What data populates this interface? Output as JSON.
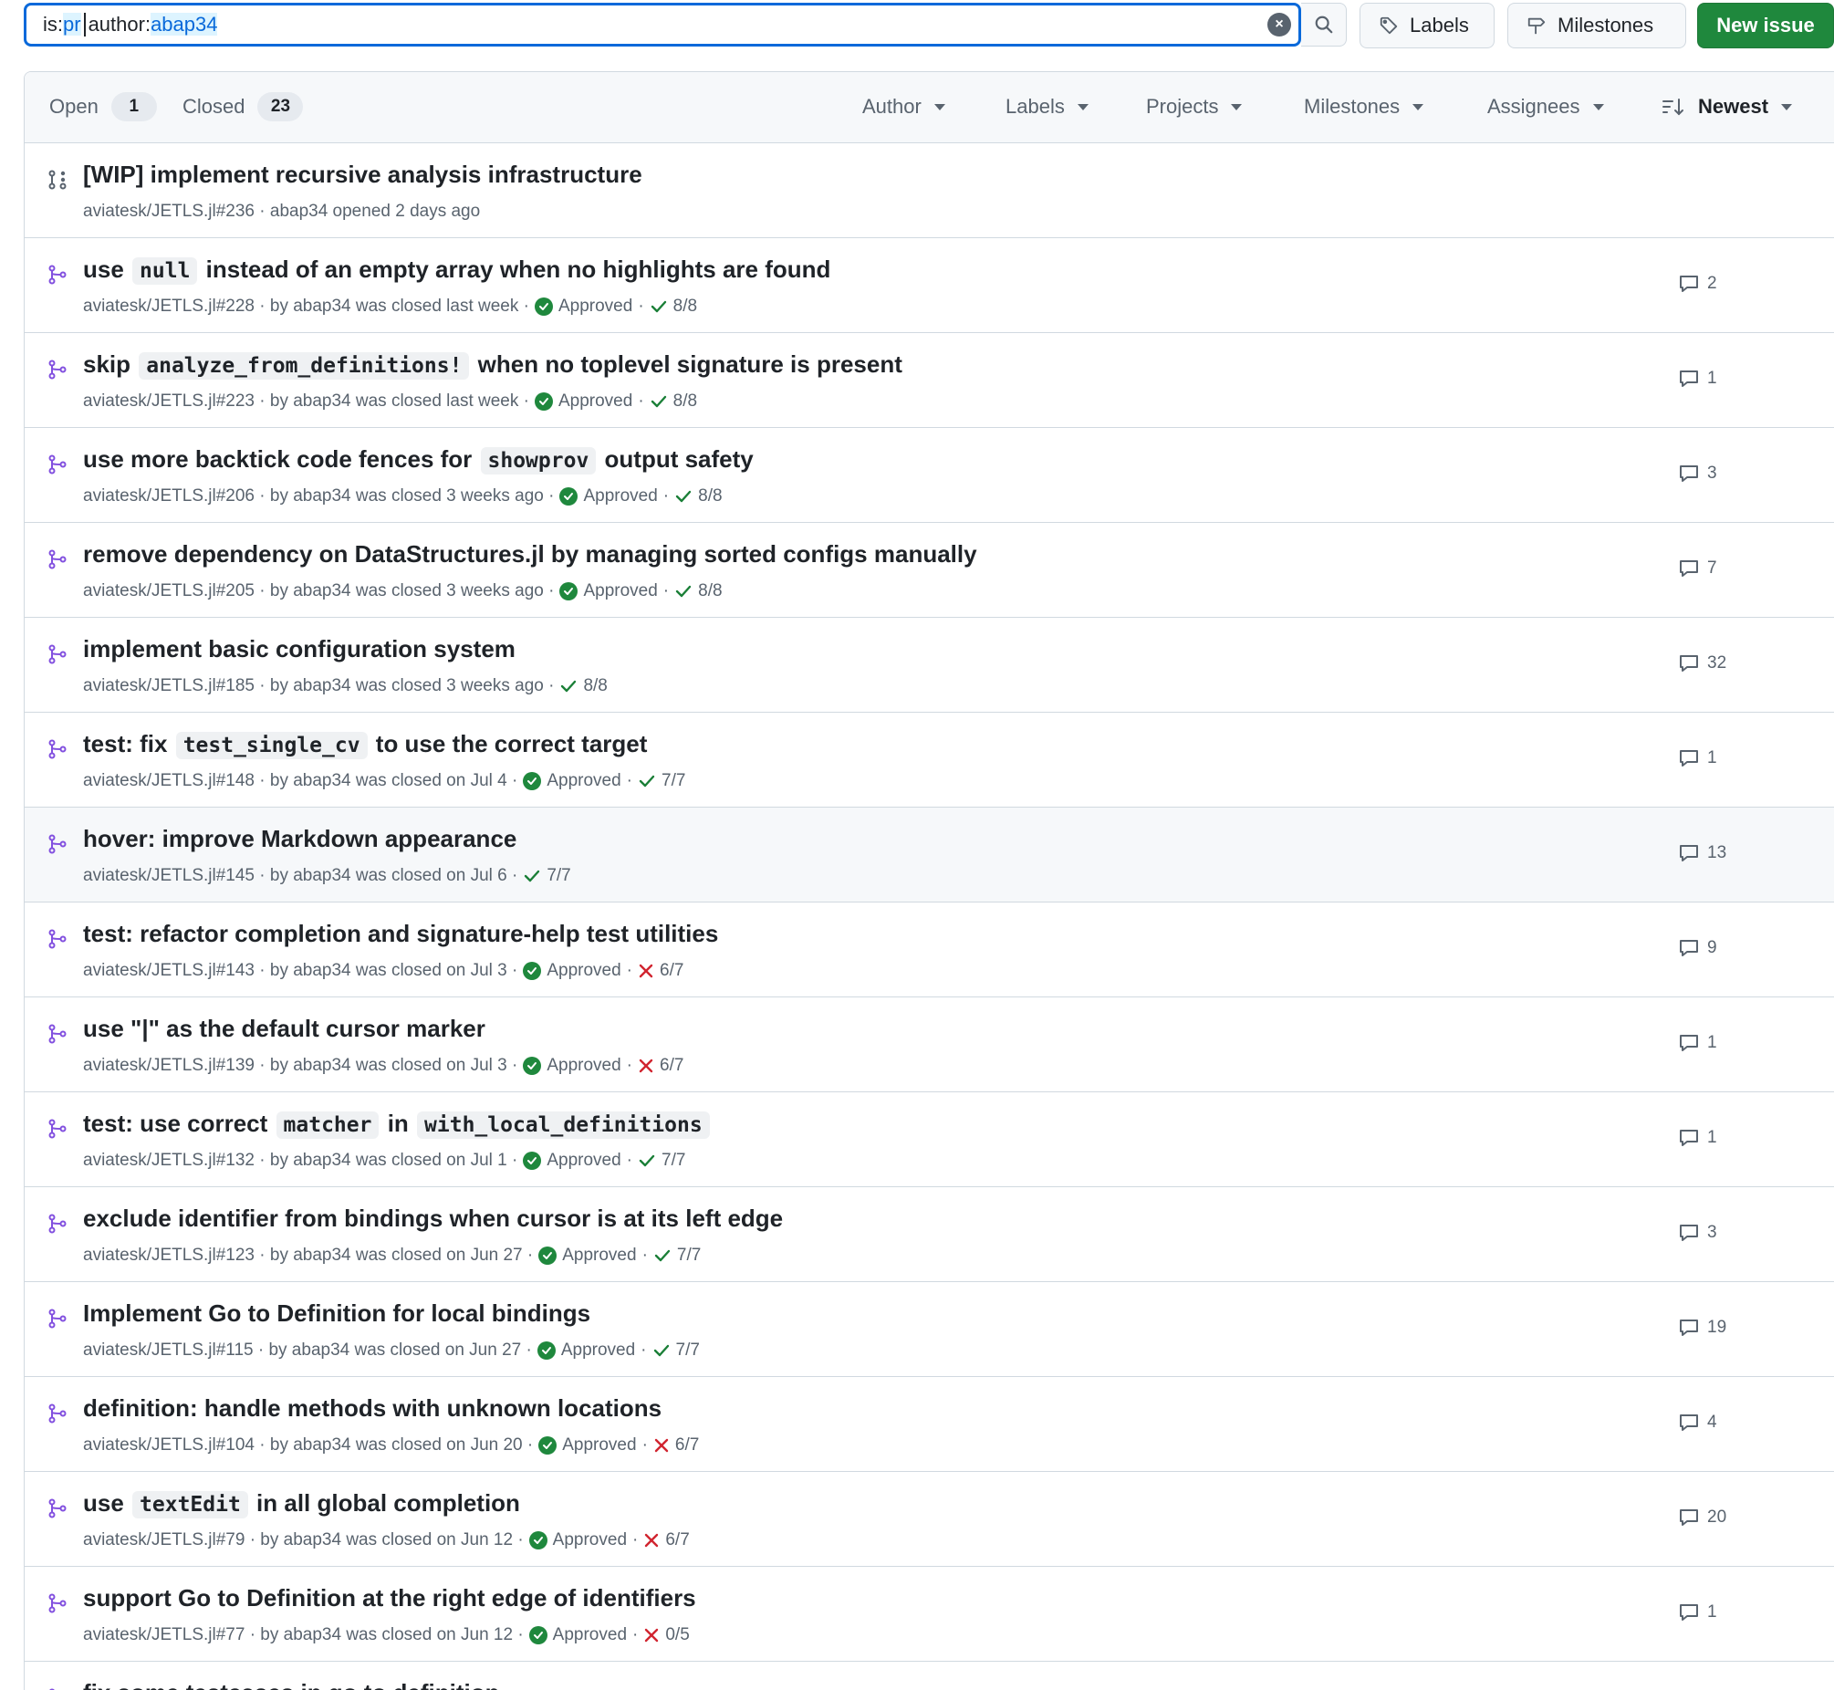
{
  "search": {
    "prefix": "is:",
    "is_value": "pr",
    "author_key": "author:",
    "author_value": "abap34"
  },
  "toolbar": {
    "labels": "Labels",
    "milestones": "Milestones",
    "new_issue": "New issue"
  },
  "states": {
    "open_label": "Open",
    "open_count": "1",
    "closed_label": "Closed",
    "closed_count": "23"
  },
  "filters": {
    "author": "Author",
    "labels": "Labels",
    "projects": "Projects",
    "milestones": "Milestones",
    "assignees": "Assignees",
    "sort": "Newest"
  },
  "colors": {
    "accent": "#0969da",
    "open_pr": "#59636e",
    "closed_pr": "#8250df",
    "success": "#1a7f37",
    "danger": "#d1242f",
    "button_green": "#1f883d"
  },
  "rows": [
    {
      "type": "draft",
      "title": [
        {
          "t": "[WIP] implement recursive analysis infrastructure"
        }
      ],
      "meta": "aviatesk/JETLS.jl#236 · abap34 opened 2 days ago",
      "approved": false,
      "ci": null,
      "ci_label": "",
      "comments": ""
    },
    {
      "type": "closed",
      "title": [
        {
          "t": "use "
        },
        {
          "c": "null"
        },
        {
          "t": " instead of an empty array when no highlights are found"
        }
      ],
      "meta": "aviatesk/JETLS.jl#228 · by abap34 was closed last week ·",
      "approved": true,
      "ci": "ok",
      "ci_label": "8/8",
      "comments": "2"
    },
    {
      "type": "closed",
      "title": [
        {
          "t": "skip "
        },
        {
          "c": "analyze_from_definitions!"
        },
        {
          "t": " when no toplevel signature is present"
        }
      ],
      "meta": "aviatesk/JETLS.jl#223 · by abap34 was closed last week ·",
      "approved": true,
      "ci": "ok",
      "ci_label": "8/8",
      "comments": "1"
    },
    {
      "type": "closed",
      "title": [
        {
          "t": "use more backtick code fences for "
        },
        {
          "c": "showprov"
        },
        {
          "t": " output safety"
        }
      ],
      "meta": "aviatesk/JETLS.jl#206 · by abap34 was closed 3 weeks ago ·",
      "approved": true,
      "ci": "ok",
      "ci_label": "8/8",
      "comments": "3"
    },
    {
      "type": "closed",
      "title": [
        {
          "t": "remove dependency on DataStructures.jl by managing sorted configs manually"
        }
      ],
      "meta": "aviatesk/JETLS.jl#205 · by abap34 was closed 3 weeks ago ·",
      "approved": true,
      "ci": "ok",
      "ci_label": "8/8",
      "comments": "7"
    },
    {
      "type": "closed",
      "title": [
        {
          "t": "implement basic configuration system"
        }
      ],
      "meta": "aviatesk/JETLS.jl#185 · by abap34 was closed 3 weeks ago ·",
      "approved": false,
      "ci": "ok",
      "ci_label": "8/8",
      "comments": "32"
    },
    {
      "type": "closed",
      "title": [
        {
          "t": "test: fix "
        },
        {
          "c": "test_single_cv"
        },
        {
          "t": " to use the correct target"
        }
      ],
      "meta": "aviatesk/JETLS.jl#148 · by abap34 was closed on Jul 4 ·",
      "approved": true,
      "ci": "ok",
      "ci_label": "7/7",
      "comments": "1"
    },
    {
      "type": "closed",
      "title": [
        {
          "t": "hover: improve Markdown appearance"
        }
      ],
      "meta": "aviatesk/JETLS.jl#145 · by abap34 was closed on Jul 6 ·",
      "approved": false,
      "ci": "ok",
      "ci_label": "7/7",
      "comments": "13",
      "highlight": true
    },
    {
      "type": "closed",
      "title": [
        {
          "t": "test: refactor completion and signature-help test utilities"
        }
      ],
      "meta": "aviatesk/JETLS.jl#143 · by abap34 was closed on Jul 3 ·",
      "approved": true,
      "ci": "fail",
      "ci_label": "6/7",
      "comments": "9"
    },
    {
      "type": "closed",
      "title": [
        {
          "t": "use \"|\" as the default cursor marker"
        }
      ],
      "meta": "aviatesk/JETLS.jl#139 · by abap34 was closed on Jul 3 ·",
      "approved": true,
      "ci": "fail",
      "ci_label": "6/7",
      "comments": "1"
    },
    {
      "type": "closed",
      "title": [
        {
          "t": "test: use correct "
        },
        {
          "c": "matcher"
        },
        {
          "t": " in "
        },
        {
          "c": "with_local_definitions"
        }
      ],
      "meta": "aviatesk/JETLS.jl#132 · by abap34 was closed on Jul 1 ·",
      "approved": true,
      "ci": "ok",
      "ci_label": "7/7",
      "comments": "1"
    },
    {
      "type": "closed",
      "title": [
        {
          "t": "exclude identifier from bindings when cursor is at its left edge"
        }
      ],
      "meta": "aviatesk/JETLS.jl#123 · by abap34 was closed on Jun 27 ·",
      "approved": true,
      "ci": "ok",
      "ci_label": "7/7",
      "comments": "3"
    },
    {
      "type": "closed",
      "title": [
        {
          "t": "Implement Go to Definition for local bindings"
        }
      ],
      "meta": "aviatesk/JETLS.jl#115 · by abap34 was closed on Jun 27 ·",
      "approved": true,
      "ci": "ok",
      "ci_label": "7/7",
      "comments": "19"
    },
    {
      "type": "closed",
      "title": [
        {
          "t": "definition: handle methods with unknown locations"
        }
      ],
      "meta": "aviatesk/JETLS.jl#104 · by abap34 was closed on Jun 20 ·",
      "approved": true,
      "ci": "fail",
      "ci_label": "6/7",
      "comments": "4"
    },
    {
      "type": "closed",
      "title": [
        {
          "t": "use "
        },
        {
          "c": "textEdit"
        },
        {
          "t": " in all global completion"
        }
      ],
      "meta": "aviatesk/JETLS.jl#79 · by abap34 was closed on Jun 12 ·",
      "approved": true,
      "ci": "fail",
      "ci_label": "6/7",
      "comments": "20"
    },
    {
      "type": "closed",
      "title": [
        {
          "t": "support Go to Definition at the right edge of identifiers"
        }
      ],
      "meta": "aviatesk/JETLS.jl#77 · by abap34 was closed on Jun 12 ·",
      "approved": true,
      "ci": "fail",
      "ci_label": "0/5",
      "comments": "1"
    },
    {
      "type": "closed",
      "title": [
        {
          "t": "fix some testcases in go to definition"
        }
      ],
      "meta": "",
      "approved": false,
      "ci": null,
      "ci_label": "",
      "comments": ""
    }
  ],
  "labels": {
    "approved": "Approved",
    "meta_sep": "·"
  }
}
